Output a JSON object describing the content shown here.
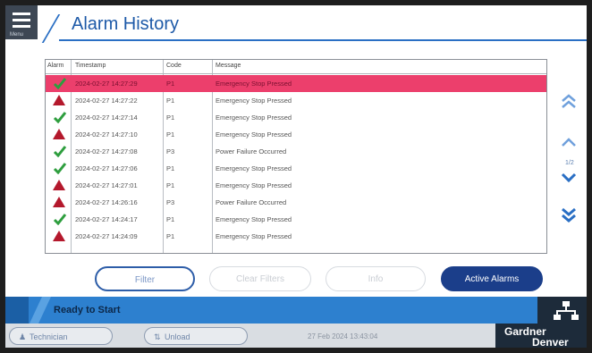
{
  "header": {
    "menu_caption": "Menu",
    "title": "Alarm History"
  },
  "table": {
    "columns": [
      "Alarm",
      "Timestamp",
      "Code",
      "Message"
    ],
    "rows": [
      {
        "status": "ok",
        "timestamp": "2024-02-27 14:27:29",
        "code": "P1",
        "message": "Emergency Stop Pressed",
        "selected": true
      },
      {
        "status": "alarm",
        "timestamp": "2024-02-27 14:27:22",
        "code": "P1",
        "message": "Emergency Stop Pressed",
        "selected": false
      },
      {
        "status": "ok",
        "timestamp": "2024-02-27 14:27:14",
        "code": "P1",
        "message": "Emergency Stop Pressed",
        "selected": false
      },
      {
        "status": "alarm",
        "timestamp": "2024-02-27 14:27:10",
        "code": "P1",
        "message": "Emergency Stop Pressed",
        "selected": false
      },
      {
        "status": "ok",
        "timestamp": "2024-02-27 14:27:08",
        "code": "P3",
        "message": "Power Failure Occurred",
        "selected": false
      },
      {
        "status": "ok",
        "timestamp": "2024-02-27 14:27:06",
        "code": "P1",
        "message": "Emergency Stop Pressed",
        "selected": false
      },
      {
        "status": "alarm",
        "timestamp": "2024-02-27 14:27:01",
        "code": "P1",
        "message": "Emergency Stop Pressed",
        "selected": false
      },
      {
        "status": "alarm",
        "timestamp": "2024-02-27 14:26:16",
        "code": "P3",
        "message": "Power Failure Occurred",
        "selected": false
      },
      {
        "status": "ok",
        "timestamp": "2024-02-27 14:24:17",
        "code": "P1",
        "message": "Emergency Stop Pressed",
        "selected": false
      },
      {
        "status": "alarm",
        "timestamp": "2024-02-27 14:24:09",
        "code": "P1",
        "message": "Emergency Stop Pressed",
        "selected": false
      }
    ]
  },
  "pagination": {
    "indicator": "1/2"
  },
  "buttons": {
    "filter": "Filter",
    "clear_filters": "Clear Filters",
    "info": "Info",
    "active_alarms": "Active Alarms"
  },
  "status_bar": {
    "text": "Ready to Start"
  },
  "footer": {
    "user": "Technician",
    "unload": "Unload",
    "datetime": "27 Feb 2024 13:43:04",
    "brand_line1": "Gardner",
    "brand_line2": "Denver"
  },
  "colors": {
    "accent": "#2a6fc4",
    "selected_row": "#ec3f6c",
    "ok_check": "#2e9e3e",
    "alarm_triangle": "#b4182c",
    "primary_button": "#1b3e8a"
  },
  "icons": {
    "ok": "check-icon",
    "alarm": "warning-triangle-icon",
    "menu": "hamburger-icon",
    "network": "network-icon"
  }
}
